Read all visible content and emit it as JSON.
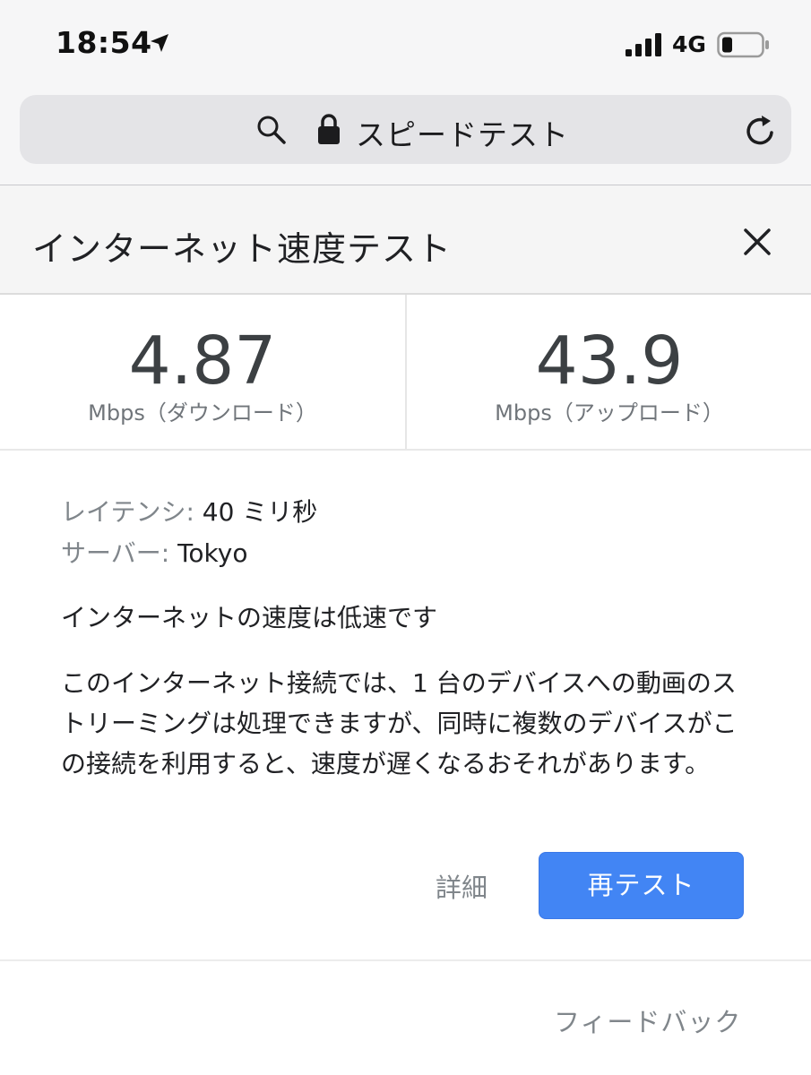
{
  "status_bar": {
    "time": "18:54",
    "network": "4G"
  },
  "address_bar": {
    "text": "スピードテスト"
  },
  "card": {
    "title": "インターネット速度テスト"
  },
  "download": {
    "value": "4.87",
    "unit": "Mbps（ダウンロード）"
  },
  "upload": {
    "value": "43.9",
    "unit": "Mbps（アップロード）"
  },
  "latency": {
    "label": "レイテンシ:",
    "value": "40 ミリ秒"
  },
  "server": {
    "label": "サーバー:",
    "value": "Tokyo"
  },
  "summary": "インターネットの速度は低速です",
  "description": "このインターネット接続では、1 台のデバイスへの動画のストリーミングは処理できますが、同時に複数のデバイスがこの接続を利用すると、速度が遅くなるおそれがあります。",
  "actions": {
    "details_label": "詳細",
    "retest_label": "再テスト"
  },
  "feedback_label": "フィードバック",
  "colors": {
    "accent": "#4285f4"
  }
}
